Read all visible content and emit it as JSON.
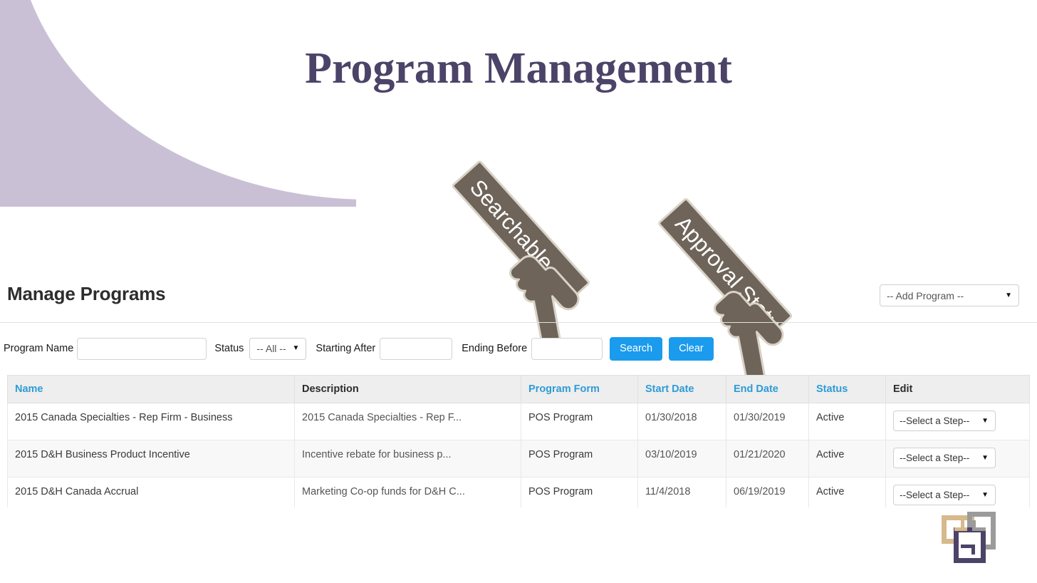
{
  "header": {
    "title": "Program Management",
    "accent_color": "#4c4368",
    "swoosh_color": "#cac0d6"
  },
  "manage": {
    "heading": "Manage Programs",
    "add_program_select": "-- Add Program --"
  },
  "filters": {
    "program_name_label": "Program Name",
    "program_name_value": "",
    "status_label": "Status",
    "status_value": "-- All --",
    "starting_after_label": "Starting After",
    "starting_after_value": "",
    "ending_before_label": "Ending Before",
    "ending_before_value": "",
    "search_button": "Search",
    "clear_button": "Clear",
    "button_color": "#1b9bed"
  },
  "table": {
    "columns": [
      {
        "label": "Name",
        "sortable": true
      },
      {
        "label": "Description",
        "sortable": false
      },
      {
        "label": "Program Form",
        "sortable": true
      },
      {
        "label": "Start Date",
        "sortable": true
      },
      {
        "label": "End Date",
        "sortable": true
      },
      {
        "label": "Status",
        "sortable": true
      },
      {
        "label": "Edit",
        "sortable": false
      }
    ],
    "rows": [
      {
        "name": "2015 Canada Specialties - Rep Firm - Business",
        "description": "2015 Canada Specialties - Rep F...",
        "program_form": "POS Program",
        "start_date": "01/30/2018",
        "end_date": "01/30/2019",
        "status": "Active",
        "edit_select": "--Select a Step--"
      },
      {
        "name": "2015 D&H Business Product Incentive",
        "description": "Incentive rebate for business p...",
        "program_form": "POS Program",
        "start_date": "03/10/2019",
        "end_date": "01/21/2020",
        "status": "Active",
        "edit_select": "--Select a Step--"
      },
      {
        "name": "2015 D&H Canada Accrual",
        "description": "Marketing Co-op funds for D&H C...",
        "program_form": "POS Program",
        "start_date": "11/4/2018",
        "end_date": "06/19/2019",
        "status": "Active",
        "edit_select": "--Select a Step--"
      }
    ],
    "header_link_color": "#2e9bd6"
  },
  "callouts": [
    {
      "label": "Searchable",
      "color": "#6e6459"
    },
    {
      "label": "Approval Status",
      "color": "#6e6459"
    }
  ],
  "logo": {
    "square_colors": [
      "#d6b98d",
      "#9b9b9b",
      "#4c4368"
    ]
  }
}
